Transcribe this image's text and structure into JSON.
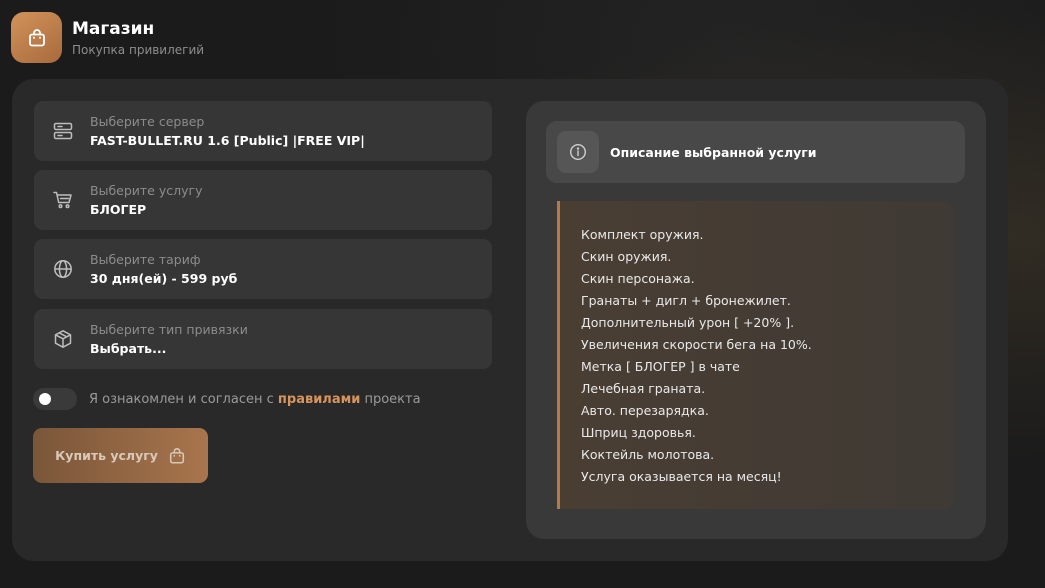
{
  "header": {
    "title": "Магазин",
    "subtitle": "Покупка привилегий",
    "icon": "shopping-bag-icon",
    "accent": "#c8864f"
  },
  "form": {
    "server": {
      "label": "Выберите сервер",
      "value": "FAST-BULLET.RU 1.6 [Public] |FREE VIP|",
      "icon": "server-icon"
    },
    "service": {
      "label": "Выберите услугу",
      "value": "БЛОГЕР",
      "icon": "cart-icon"
    },
    "tariff": {
      "label": "Выберите тариф",
      "value": "30 дня(ей) - 599 руб",
      "icon": "globe-icon"
    },
    "binding": {
      "label": "Выберите тип привязки",
      "value": "Выбрать...",
      "icon": "box-icon"
    },
    "agreement": {
      "text_before": "Я ознакомлен и согласен с ",
      "link": "правилами",
      "text_after": " проекта",
      "checked": false
    },
    "buy_label": "Купить услугу"
  },
  "description": {
    "title": "Описание выбранной услуги",
    "icon": "info-icon",
    "items": [
      "Комплект оружия.",
      "Скин оружия.",
      "Скин персонажа.",
      "Гранаты + дигл + бронежилет.",
      "Дополнительный урон [ +20% ].",
      "Увеличения скорости бега на 10%.",
      "Метка [ БЛОГЕР ] в чате",
      "Лечебная граната.",
      "Авто. перезарядка.",
      "Шприц здоровья.",
      "Коктейль молотова.",
      "Услуга оказывается на месяц!"
    ]
  }
}
